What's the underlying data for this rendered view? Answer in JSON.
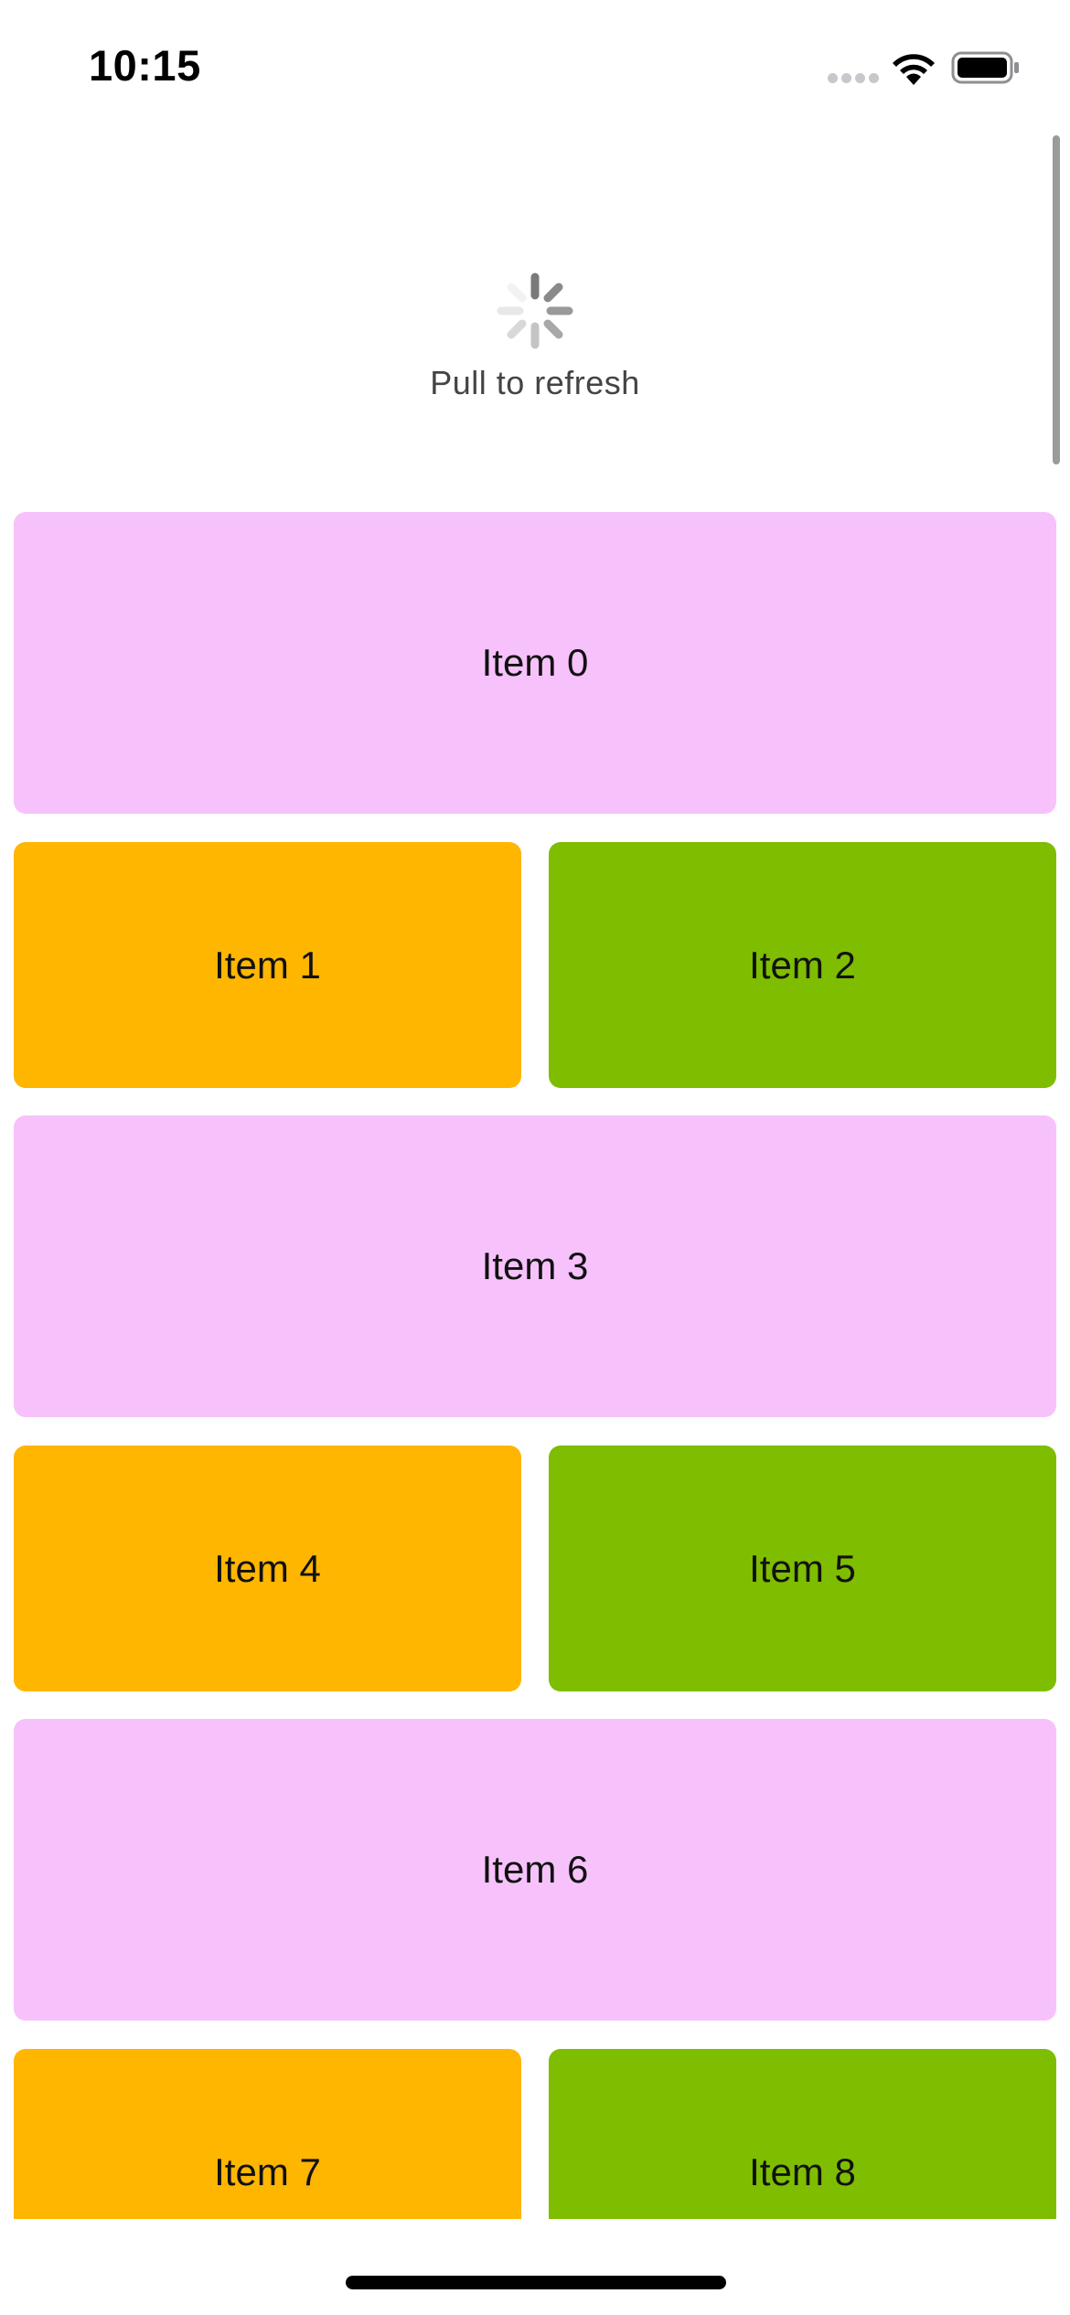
{
  "status_bar": {
    "time": "10:15",
    "icons": [
      "signal-dots-icon",
      "wifi-icon",
      "battery-icon"
    ]
  },
  "refresh": {
    "label": "Pull to refresh",
    "icon": "spinner-icon"
  },
  "items": [
    {
      "label": "Item 0",
      "color": "#f7c2fb"
    },
    {
      "label": "Item 1",
      "color": "#feb601"
    },
    {
      "label": "Item 2",
      "color": "#7ebd00"
    },
    {
      "label": "Item 3",
      "color": "#f7c2fb"
    },
    {
      "label": "Item 4",
      "color": "#feb601"
    },
    {
      "label": "Item 5",
      "color": "#7ebd00"
    },
    {
      "label": "Item 6",
      "color": "#f7c2fb"
    },
    {
      "label": "Item 7",
      "color": "#feb601"
    },
    {
      "label": "Item 8",
      "color": "#7ebd00"
    }
  ]
}
